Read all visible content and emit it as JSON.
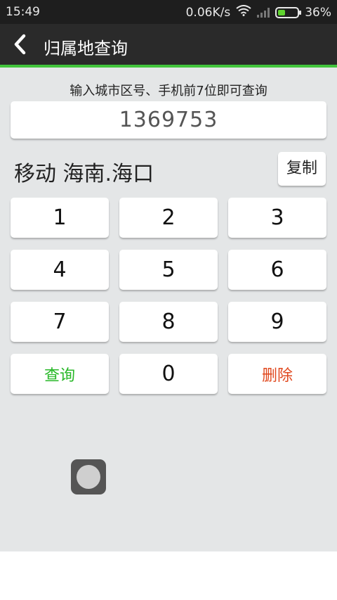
{
  "status_bar": {
    "time": "15:49",
    "network_speed": "0.06K/s",
    "battery_percent": "36%",
    "battery_level": 0.36,
    "icons": [
      "wifi-icon",
      "signal-icon",
      "battery-icon"
    ],
    "battery_color": "#5fd32f"
  },
  "header": {
    "back_icon": "chevron-left-icon",
    "title": "归属地查询",
    "accent_color": "#41c43b"
  },
  "main": {
    "hint": "输入城市区号、手机前7位即可查询",
    "number_value": "1369753",
    "result": "移动 海南.海口",
    "copy_label": "复制"
  },
  "keypad": {
    "k1": "1",
    "k2": "2",
    "k3": "3",
    "k4": "4",
    "k5": "5",
    "k6": "6",
    "k7": "7",
    "k8": "8",
    "k9": "9",
    "query": "查询",
    "k0": "0",
    "delete": "删除",
    "query_color": "#28b828",
    "delete_color": "#e0481e"
  }
}
